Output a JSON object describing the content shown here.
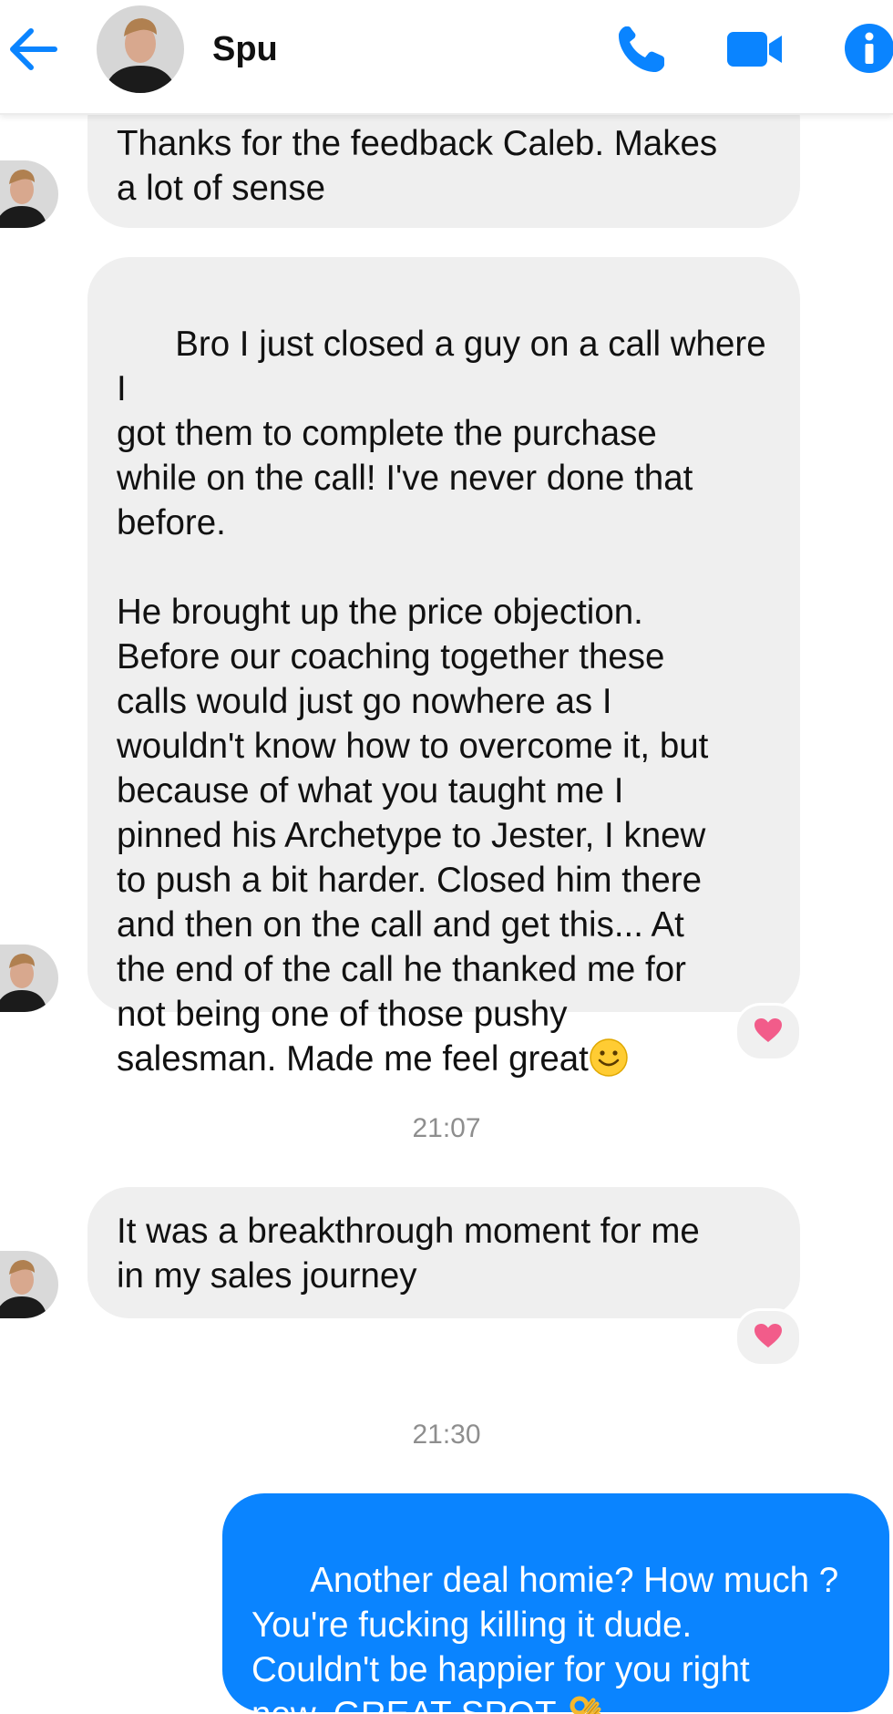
{
  "header": {
    "contact_name": "Spu",
    "back_icon": "back-arrow-icon",
    "call_icon": "phone-icon",
    "video_icon": "video-camera-icon",
    "info_icon": "info-icon"
  },
  "colors": {
    "accent": "#0a84ff",
    "incoming_bubble": "#efefef",
    "reaction_heart": "#f25c8a",
    "timestamp_text": "#8e8e8e"
  },
  "messages": [
    {
      "direction": "incoming",
      "text": "Thanks for the feedback Caleb. Makes\na lot of sense",
      "reaction": null
    },
    {
      "direction": "incoming",
      "text": "Bro I just closed a guy on a call where I\ngot them to complete the purchase\nwhile on the call! I've never done that\nbefore.\n\nHe brought up the price objection.\nBefore our coaching together these\ncalls would just go nowhere as I\nwouldn't know how to overcome it, but\nbecause of what you taught me I\npinned his Archetype to Jester, I knew\nto push a bit harder. Closed him there\nand then on the call and get this... At\nthe end of the call he thanked me for\nnot being one of those pushy\nsalesman. Made me feel great",
      "trailing_emoji": "smiling-face-emoji",
      "reaction": "heart-icon"
    },
    {
      "direction": "timestamp",
      "text": "21:07"
    },
    {
      "direction": "incoming",
      "text": "It was a breakthrough moment for me\nin my sales journey",
      "reaction": "heart-icon"
    },
    {
      "direction": "timestamp",
      "text": "21:30"
    },
    {
      "direction": "outgoing",
      "text": "Another deal homie? How much ?\nYou're fucking killing it dude.\nCouldn't be happier for you right\nnow. GREAT SPOT",
      "trailing_emoji": "ok-hand-emoji",
      "reaction": null
    }
  ]
}
